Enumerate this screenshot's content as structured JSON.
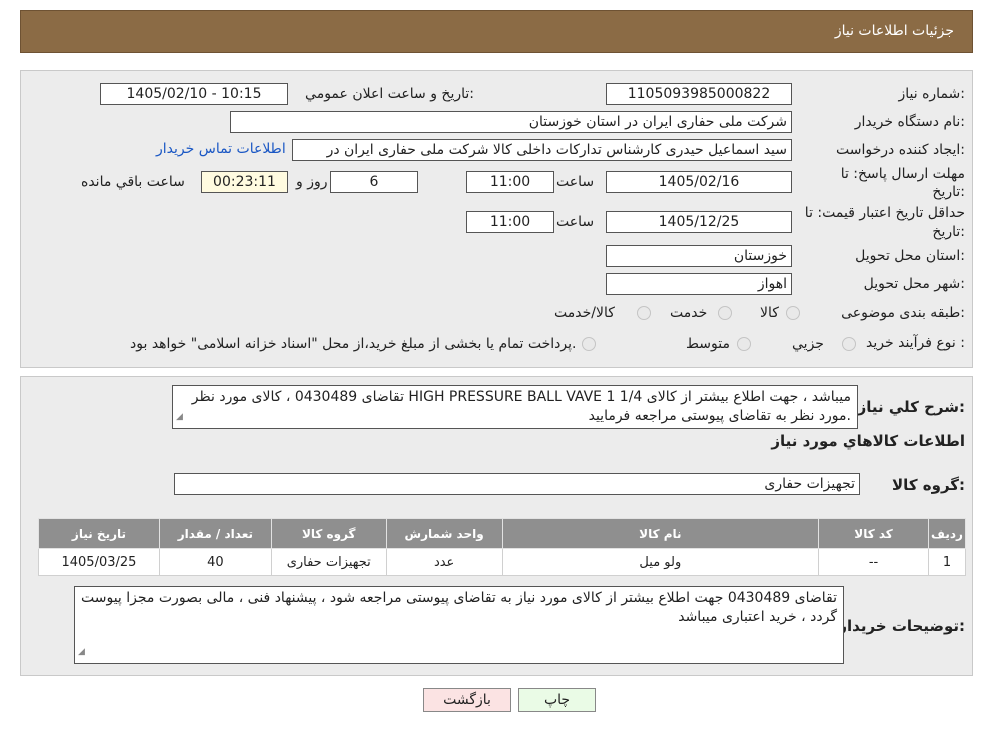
{
  "header": {
    "title": "جزئیات اطلاعات نیاز"
  },
  "form": {
    "need_number_label": "شماره نیاز:",
    "need_number": "1105093985000822",
    "announce_label": "تاریخ و ساعت اعلان عمومي:",
    "announce_value": "1405/02/10 - 10:15",
    "buyer_label": "نام دستگاه خريدار:",
    "buyer_value": "شرکت ملی حفاری ایران در استان خوزستان",
    "creator_label": "ايجاد کننده درخواست:",
    "creator_value": "سید اسماعیل حیدری کارشناس تدارکات داخلی کالا شرکت ملی حفاری ایران در",
    "contact_link": "اطلاعات تماس خريدار",
    "deadline_label_1": "مهلت ارسال پاسخ: تا",
    "deadline_label_2": "تاريخ:",
    "deadline_date": "1405/02/16",
    "time_label": "ساعت",
    "deadline_time": "11:00",
    "days_value": "6",
    "days_label": "روز و",
    "remaining_value": "00:23:11",
    "remaining_label": "ساعت باقي مانده",
    "validity_label_1": "حداقل تاريخ اعتبار قيمت: تا",
    "validity_label_2": "تاريخ:",
    "validity_date": "1405/12/25",
    "validity_time": "11:00",
    "province_label": "استان محل تحويل:",
    "province_value": "خوزستان",
    "city_label": "شهر محل تحويل:",
    "city_value": "اهواز",
    "category_label": "طبقه بندی موضوعی:",
    "category_options": [
      "کالا",
      "خدمت",
      "کالا/خدمت"
    ],
    "process_label": "نوع فرآيند خريد :",
    "process_options": [
      "جزيي",
      "متوسط"
    ],
    "process_note": "پرداخت تمام یا بخشی از مبلغ خرید،از محل \"اسناد خزانه اسلامی\" خواهد بود."
  },
  "description": {
    "summary_label": "شرح کلي نياز:",
    "summary_text": "تقاضای 0430489 ، کالای مورد نظر  HIGH PRESSURE BALL VAVE  1 1/4  میباشد ، جهت اطلاع بیشتر از کالای مورد نظر به تقاضای پیوستی مراجعه فرمایید.",
    "goods_info_title": "اطلاعات کالاهاي مورد نياز",
    "group_label": "گروه کالا:",
    "group_value": "تجهیزات حفاری"
  },
  "table": {
    "headers": [
      "رديف",
      "کد کالا",
      "نام کالا",
      "واحد شمارش",
      "گروه کالا",
      "تعداد / مقدار",
      "تاريخ نياز"
    ],
    "rows": [
      [
        "1",
        "--",
        "ولو میل",
        "عدد",
        "تجهیزات حفاری",
        "40",
        "1405/03/25"
      ]
    ]
  },
  "buyer_notes": {
    "label": "توضيحات خريدار:",
    "text": "تقاضای 0430489 جهت اطلاع بیشتر از کالای مورد نیاز به تقاضای پیوستی مراجعه شود ، پیشنهاد فنی ، مالی بصورت مجزا پیوست گردد ، خرید اعتباری میباشد"
  },
  "buttons": {
    "print": "چاپ",
    "back": "بازگشت"
  }
}
